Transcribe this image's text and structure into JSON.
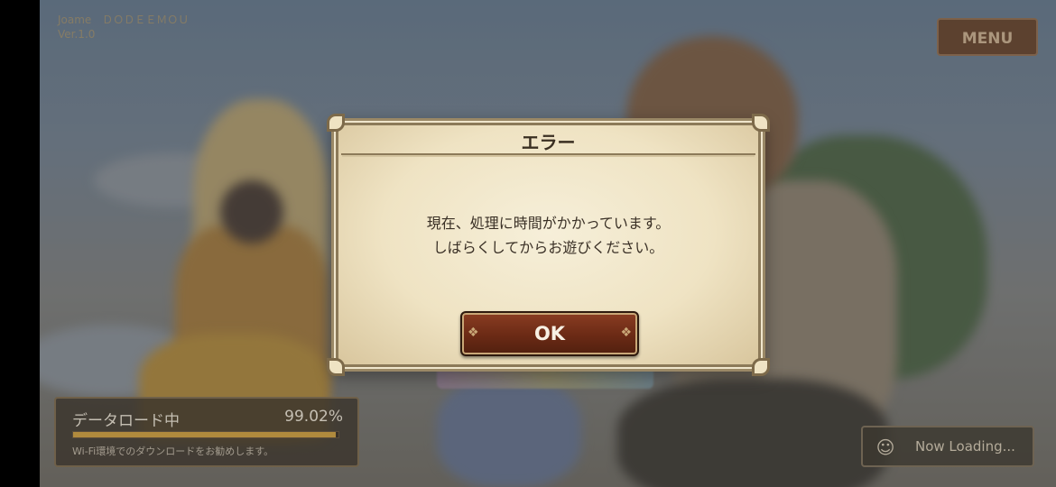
{
  "header": {
    "user_name": "Joame　ＤＯＤＥＥＭＯＵ",
    "user_sub": "Ver.1.0",
    "menu_label": "MENU"
  },
  "dialog": {
    "title": "エラー",
    "message": "現在、処理に時間がかかっています。\nしばらくしてからお遊びください。",
    "ok_label": "OK"
  },
  "data_load": {
    "label": "データロード中",
    "percent_text": "99.02%",
    "progress": 0.9902,
    "note": "Wi-Fi環境でのダウンロードをお勧めします。"
  },
  "now_loading": {
    "label": "Now Loading...",
    "icon": "chibi-character-icon"
  },
  "colors": {
    "dialog_bg": "#efe3c3",
    "ok_button": "#6b2a15",
    "progress_fill": "#b08a3d"
  }
}
